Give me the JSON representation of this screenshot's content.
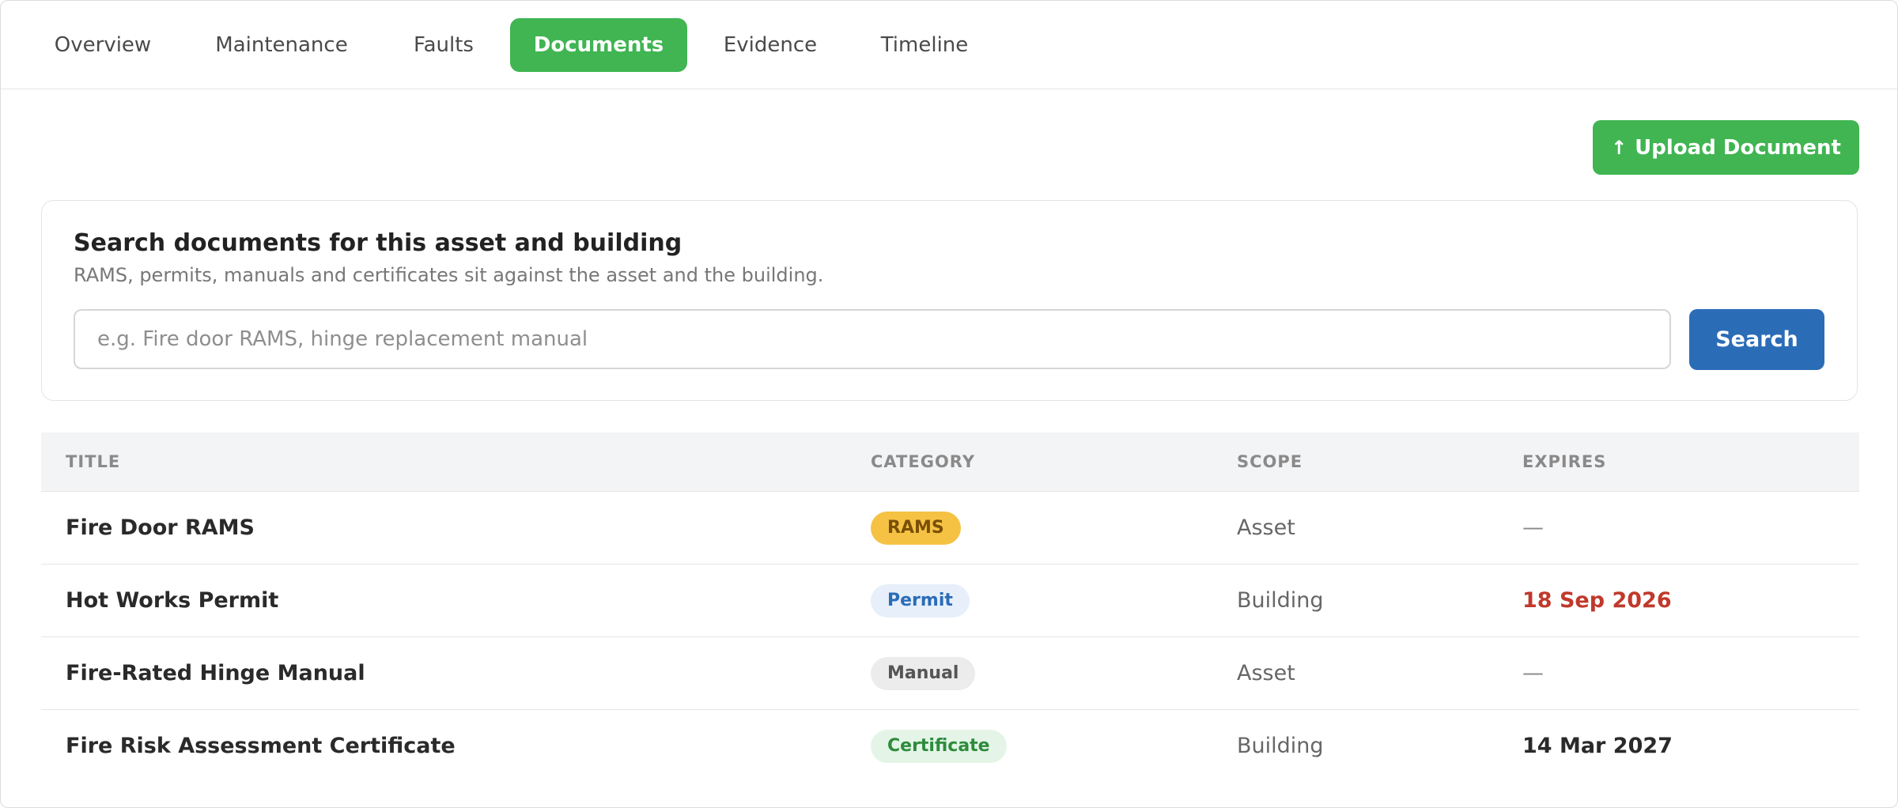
{
  "tabs": [
    {
      "label": "Overview",
      "active": false
    },
    {
      "label": "Maintenance",
      "active": false
    },
    {
      "label": "Faults",
      "active": false
    },
    {
      "label": "Documents",
      "active": true
    },
    {
      "label": "Evidence",
      "active": false
    },
    {
      "label": "Timeline",
      "active": false
    }
  ],
  "toolbar": {
    "upload_label": "Upload Document",
    "upload_icon": "↑"
  },
  "search": {
    "title": "Search documents for this asset and building",
    "subtitle": "RAMS, permits, manuals and certificates sit against the asset and the building.",
    "placeholder": "e.g. Fire door RAMS, hinge replacement manual",
    "value": "",
    "button_label": "Search"
  },
  "table": {
    "headers": {
      "title": "TITLE",
      "category": "CATEGORY",
      "scope": "SCOPE",
      "expires": "EXPIRES"
    },
    "rows": [
      {
        "title": "Fire Door RAMS",
        "category": "RAMS",
        "scope": "Asset",
        "expires": "—"
      },
      {
        "title": "Hot Works Permit",
        "category": "Permit",
        "scope": "Building",
        "expires": "18 Sep 2026"
      },
      {
        "title": "Fire-Rated Hinge Manual",
        "category": "Manual",
        "scope": "Asset",
        "expires": "—"
      },
      {
        "title": "Fire Risk Assessment Certificate",
        "category": "Certificate",
        "scope": "Building",
        "expires": "14 Mar 2027"
      }
    ]
  },
  "colors": {
    "accent_green": "#40b552",
    "primary_blue": "#2b6cb7",
    "expiry_warning": "#c0392b",
    "badge_rams_bg": "#f6c244",
    "badge_rams_fg": "#7a4f06",
    "badge_permit_bg": "#e6effa",
    "badge_permit_fg": "#2b6cb7",
    "badge_manual_bg": "#ececec",
    "badge_manual_fg": "#555555",
    "badge_certificate_bg": "#e4f5e7",
    "badge_certificate_fg": "#2e8b3d"
  }
}
